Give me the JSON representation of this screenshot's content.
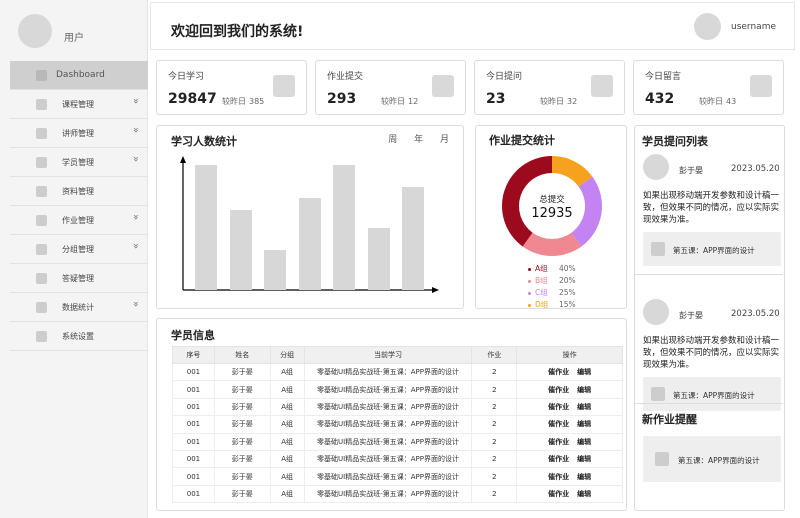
{
  "sidebar": {
    "username": "用户",
    "items": [
      {
        "label": "Dashboard",
        "active": true,
        "expandable": false
      },
      {
        "label": "课程管理",
        "active": false,
        "expandable": true
      },
      {
        "label": "讲师管理",
        "active": false,
        "expandable": true
      },
      {
        "label": "学员管理",
        "active": false,
        "expandable": true
      },
      {
        "label": "资料管理",
        "active": false,
        "expandable": false
      },
      {
        "label": "作业管理",
        "active": false,
        "expandable": true
      },
      {
        "label": "分组管理",
        "active": false,
        "expandable": true
      },
      {
        "label": "答疑管理",
        "active": false,
        "expandable": false
      },
      {
        "label": "数据统计",
        "active": false,
        "expandable": true
      },
      {
        "label": "系统设置",
        "active": false,
        "expandable": false
      }
    ],
    "chevron": "»"
  },
  "header": {
    "welcome": "欢迎回到我们的系统!",
    "username": "username"
  },
  "stats": [
    {
      "title": "今日学习",
      "value": "29847",
      "compare_label": "较昨日",
      "compare_value": "385"
    },
    {
      "title": "作业提交",
      "value": "293",
      "compare_label": "较昨日",
      "compare_value": "12"
    },
    {
      "title": "今日提问",
      "value": "23",
      "compare_label": "较昨日",
      "compare_value": "32"
    },
    {
      "title": "今日留言",
      "value": "432",
      "compare_label": "较昨日",
      "compare_value": "43"
    }
  ],
  "study_chart": {
    "title": "学习人数统计",
    "tabs": [
      "周",
      "年",
      "月"
    ]
  },
  "homework_chart": {
    "title": "作业提交统计",
    "center_label": "总提交",
    "center_value": "12935"
  },
  "qa_list": {
    "title": "学员提问列表",
    "items": [
      {
        "name": "彭于晏",
        "date": "2023.05.20",
        "text": "如果出现移动端开发参数和设计稿一致，但效果不同的情况，应以实际实现效果为准。",
        "lesson": "第五课：APP界面的设计"
      },
      {
        "name": "彭于晏",
        "date": "2023.05.20",
        "text": "如果出现移动端开发参数和设计稿一致，但效果不同的情况，应以实际实现效果为准。",
        "lesson": "第五课：APP界面的设计"
      }
    ]
  },
  "new_homework": {
    "title": "新作业提醒",
    "lesson": "第五课：APP界面的设计"
  },
  "students": {
    "title": "学员信息",
    "columns": [
      "序号",
      "姓名",
      "分组",
      "当前学习",
      "作业",
      "操作"
    ],
    "action_labels": [
      "催作业",
      "编辑"
    ],
    "rows": [
      [
        "001",
        "彭于晏",
        "A组",
        "零基础UI精品实战班-第五课：APP界面的设计",
        "2"
      ],
      [
        "001",
        "彭于晏",
        "A组",
        "零基础UI精品实战班-第五课：APP界面的设计",
        "2"
      ],
      [
        "001",
        "彭于晏",
        "A组",
        "零基础UI精品实战班-第五课：APP界面的设计",
        "2"
      ],
      [
        "001",
        "彭于晏",
        "A组",
        "零基础UI精品实战班-第五课：APP界面的设计",
        "2"
      ],
      [
        "001",
        "彭于晏",
        "A组",
        "零基础UI精品实战班-第五课：APP界面的设计",
        "2"
      ],
      [
        "001",
        "彭于晏",
        "A组",
        "零基础UI精品实战班-第五课：APP界面的设计",
        "2"
      ],
      [
        "001",
        "彭于晏",
        "A组",
        "零基础UI精品实战班-第五课：APP界面的设计",
        "2"
      ],
      [
        "001",
        "彭于晏",
        "A组",
        "零基础UI精品实战班-第五课：APP界面的设计",
        "2"
      ]
    ]
  },
  "chart_data": [
    {
      "type": "bar",
      "title": "学习人数统计",
      "categories": [],
      "values": [
        125,
        80,
        40,
        92,
        125,
        62,
        103
      ],
      "ylim": [
        0,
        130
      ],
      "grid": false,
      "bar_color": "#d7d7d7"
    },
    {
      "type": "pie",
      "title": "作业提交统计",
      "labels": [
        "A组",
        "B组",
        "C组",
        "D组"
      ],
      "values": [
        40,
        20,
        25,
        15
      ],
      "value_labels": [
        "40%",
        "20%",
        "25%",
        "15%"
      ],
      "colors": [
        "#9c0a1e",
        "#ef8890",
        "#c383f2",
        "#f6a21e"
      ],
      "order_clockwise_from_top": [
        "D组",
        "C组",
        "B组",
        "A组"
      ],
      "donut": true
    }
  ]
}
